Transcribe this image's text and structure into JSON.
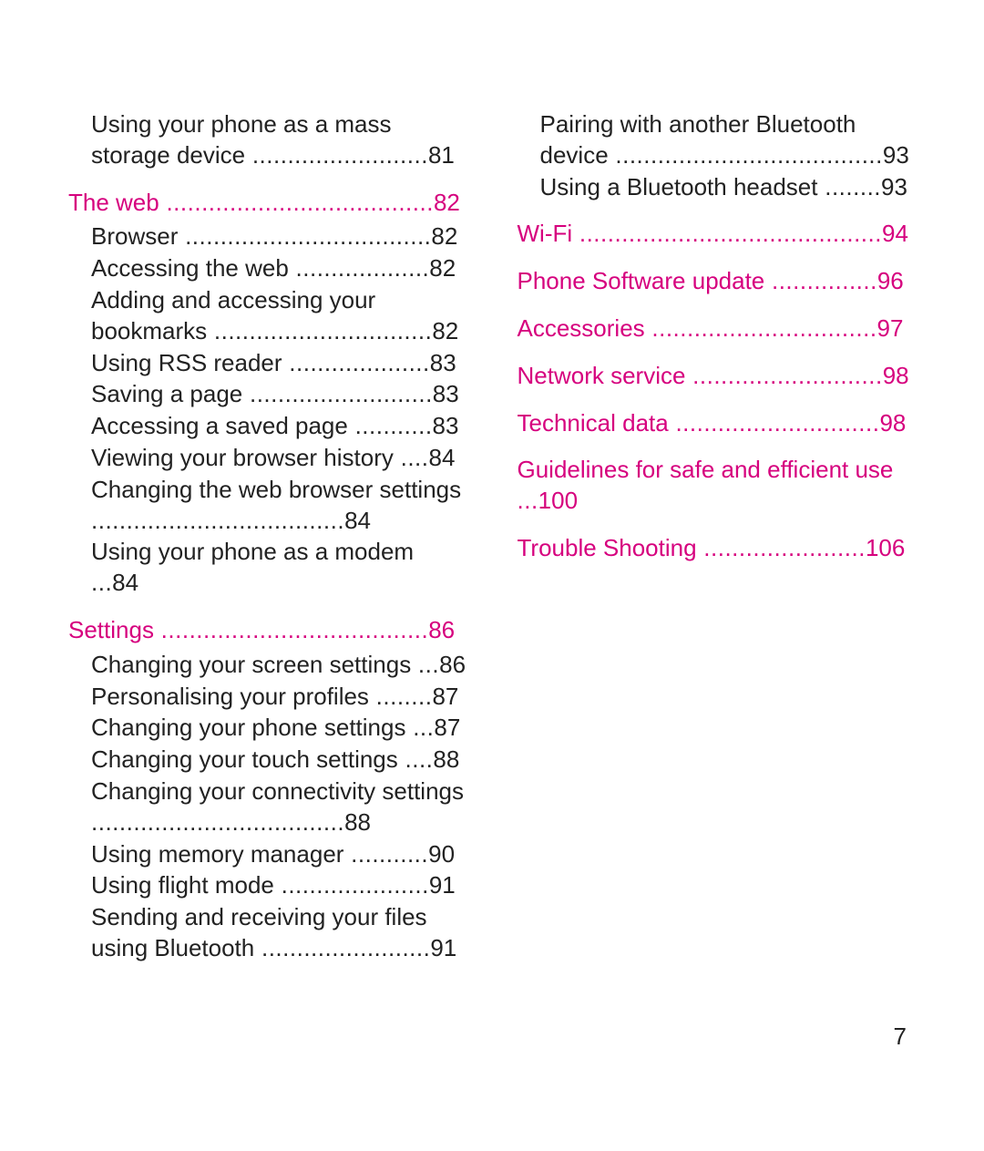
{
  "page_number": "7",
  "left_column": [
    {
      "type": "sub",
      "items": [
        {
          "label": "Using your phone as a mass storage device",
          "page": "81"
        }
      ],
      "first": true
    },
    {
      "type": "section",
      "title": "The web",
      "page": "82",
      "items": [
        {
          "label": "Browser",
          "page": "82"
        },
        {
          "label": "Accessing the web",
          "page": "82"
        },
        {
          "label": "Adding and accessing your bookmarks",
          "page": "82"
        },
        {
          "label": "Using RSS reader",
          "page": "83"
        },
        {
          "label": "Saving a page",
          "page": "83"
        },
        {
          "label": "Accessing a saved page",
          "page": "83"
        },
        {
          "label": "Viewing your browser history",
          "page": "84"
        },
        {
          "label": "Changing the web browser settings",
          "page": "84"
        },
        {
          "label": "Using your phone as a modem",
          "page": "84"
        }
      ]
    },
    {
      "type": "section",
      "title": "Settings",
      "page": "86",
      "items": [
        {
          "label": "Changing your screen settings",
          "page": "86"
        },
        {
          "label": "Personalising your profiles",
          "page": "87"
        },
        {
          "label": "Changing your phone settings",
          "page": "87"
        },
        {
          "label": "Changing your touch settings",
          "page": "88"
        },
        {
          "label": "Changing your connectivity settings",
          "page": "88"
        },
        {
          "label": "Using memory manager",
          "page": "90"
        },
        {
          "label": "Using flight mode",
          "page": "91"
        },
        {
          "label": "Sending and receiving your files using Bluetooth",
          "page": "91"
        }
      ]
    }
  ],
  "right_column": [
    {
      "type": "sub",
      "items": [
        {
          "label": "Pairing with another Bluetooth device",
          "page": "93"
        },
        {
          "label": "Using a Bluetooth headset",
          "page": "93"
        }
      ],
      "first": true
    },
    {
      "type": "section",
      "title": "Wi-Fi",
      "page": "94",
      "items": []
    },
    {
      "type": "section",
      "title": "Phone Software update",
      "page": "96",
      "items": []
    },
    {
      "type": "section",
      "title": "Accessories",
      "page": "97",
      "items": []
    },
    {
      "type": "section",
      "title": "Network service",
      "page": "98",
      "items": []
    },
    {
      "type": "section",
      "title": "Technical data",
      "page": "98",
      "items": []
    },
    {
      "type": "section",
      "title": "Guidelines for safe and efficient use",
      "page": "100",
      "items": []
    },
    {
      "type": "section",
      "title": "Trouble Shooting",
      "page": "106",
      "items": []
    }
  ]
}
